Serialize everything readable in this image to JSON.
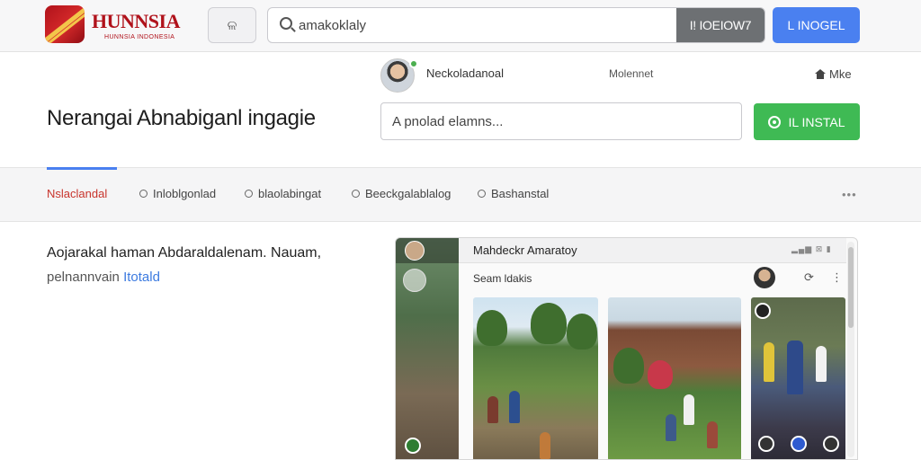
{
  "header": {
    "brand": "HUNNSIA",
    "brand_sub": "HUNNSIA INDONESIA",
    "tile_button_label": "ଳ",
    "search_placeholder": "amakoklaly",
    "search_button": "I! IOEIOW7",
    "top_button": "L INOGEL"
  },
  "hero": {
    "user_name": "Neckoladanoal",
    "meta_label": "Molennet",
    "mode_link": "Mke",
    "title": "Nerangai Abnabiganl ingagie",
    "prompt_placeholder": "A pnolad elamns...",
    "install_button": "IL INSTAL"
  },
  "tabs": [
    {
      "label": "Nslaclandal",
      "active": true
    },
    {
      "label": "Inloblgonlad",
      "active": false
    },
    {
      "label": "blaolabingat",
      "active": false
    },
    {
      "label": "Beeckgalablalog",
      "active": false
    },
    {
      "label": "Bashanstal",
      "active": false
    }
  ],
  "tabs_more": "•••",
  "content": {
    "desc_line1": "Aojarakal haman Abdaraldalenam. Nauam,",
    "desc_line2": "pelnannvain",
    "desc_link": "Itotald"
  },
  "preview": {
    "title": "Mahdeckr Amaratoy",
    "subtitle": "Seam ldakis",
    "signal": "▂▄▆ ⊠ ▮",
    "share_icon": "⟳",
    "kebab_icon": "⋮"
  },
  "colors": {
    "brand_red": "#b0121b",
    "accent_blue": "#4a80f0",
    "install_green": "#3fba54",
    "active_tab": "#c8342c"
  }
}
